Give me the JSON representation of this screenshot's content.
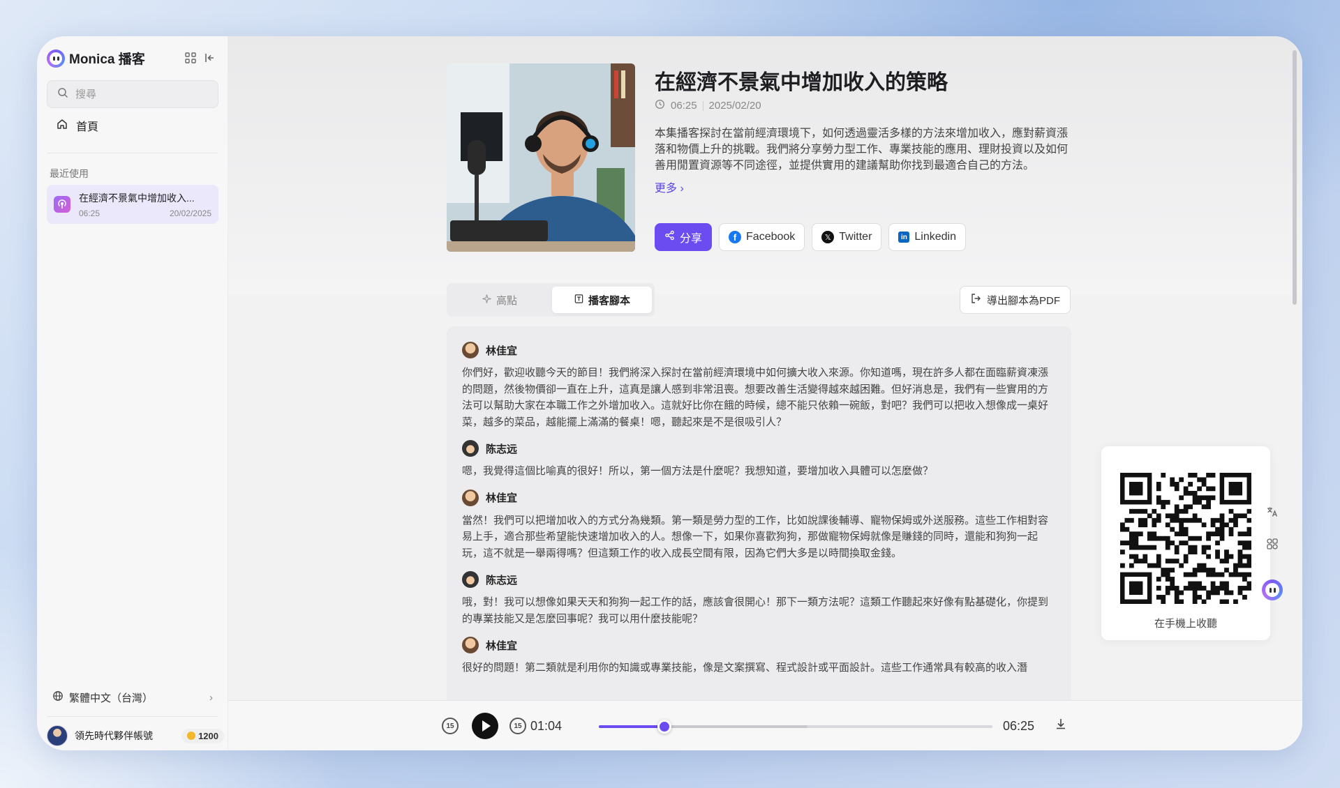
{
  "app": {
    "brand": "Monica 播客",
    "search_placeholder": "搜尋"
  },
  "sidebar": {
    "home_label": "首頁",
    "recent_label": "最近使用",
    "recent_items": [
      {
        "title": "在經濟不景氣中增加收入...",
        "duration": "06:25",
        "date": "20/02/2025"
      }
    ],
    "language": "繁體中文（台灣）",
    "user_name": "領先時代夥伴帳號",
    "credits": "1200"
  },
  "episode": {
    "title": "在經濟不景氣中增加收入的策略",
    "duration": "06:25",
    "date": "2025/02/20",
    "description": "本集播客探討在當前經濟環境下，如何透過靈活多樣的方法來增加收入，應對薪資漲落和物價上升的挑戰。我們將分享勞力型工作、專業技能的應用、理財投資以及如何善用閒置資源等不同途徑，並提供實用的建議幫助你找到最適合自己的方法。",
    "more_label": "更多 ›"
  },
  "actions": {
    "share": "分享",
    "facebook": "Facebook",
    "twitter": "Twitter",
    "linkedin": "Linkedin"
  },
  "tabs": {
    "highlights": "高點",
    "script": "播客腳本",
    "export": "導出腳本為PDF"
  },
  "script": [
    {
      "speaker": "林佳宜",
      "text": "你們好，歡迎收聽今天的節目！我們將深入探討在當前經濟環境中如何擴大收入來源。你知道嗎，現在許多人都在面臨薪資凍漲的問題，然後物價卻一直在上升，這真是讓人感到非常沮喪。想要改善生活變得越來越困難。但好消息是，我們有一些實用的方法可以幫助大家在本職工作之外增加收入。這就好比你在餓的時候，總不能只依賴一碗飯，對吧？我們可以把收入想像成一桌好菜，越多的菜品，越能擺上滿滿的餐桌！嗯，聽起來是不是很吸引人？"
    },
    {
      "speaker": "陈志远",
      "text": "嗯，我覺得這個比喻真的很好！所以，第一個方法是什麼呢？我想知道，要增加收入具體可以怎麼做？"
    },
    {
      "speaker": "林佳宜",
      "text": "當然！我們可以把增加收入的方式分為幾類。第一類是勞力型的工作，比如說課後輔導、寵物保姆或外送服務。這些工作相對容易上手，適合那些希望能快速增加收入的人。想像一下，如果你喜歡狗狗，那做寵物保姆就像是賺錢的同時，還能和狗狗一起玩，這不就是一舉兩得嗎？但這類工作的收入成長空間有限，因為它們大多是以時間換取金錢。"
    },
    {
      "speaker": "陈志远",
      "text": "哦，對！我可以想像如果天天和狗狗一起工作的話，應該會很開心！那下一類方法呢？這類工作聽起來好像有點基礎化，你提到的專業技能又是怎麼回事呢？我可以用什麼技能呢？"
    },
    {
      "speaker": "林佳宜",
      "text": "很好的問題！第二類就是利用你的知識或專業技能，像是文案撰寫、程式設計或平面設計。這些工作通常具有較高的收入潛"
    }
  ],
  "player": {
    "current_time": "01:04",
    "total_time": "06:25",
    "skip_back": "15",
    "skip_forward": "15",
    "progress": 0.166
  },
  "qr": {
    "caption": "在手機上收聽"
  },
  "colors": {
    "accent": "#6a4cf0",
    "facebook": "#1877f2",
    "linkedin": "#0a66c2"
  }
}
